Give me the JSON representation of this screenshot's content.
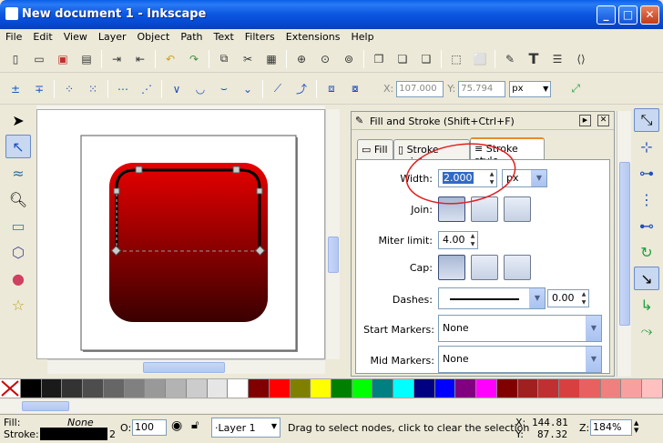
{
  "window": {
    "title": "New document 1 - Inkscape",
    "controls": {
      "minimize": "_",
      "maximize": "□",
      "close": "✕"
    }
  },
  "menubar": [
    "File",
    "Edit",
    "View",
    "Layer",
    "Object",
    "Path",
    "Text",
    "Filters",
    "Extensions",
    "Help"
  ],
  "node_toolbar": {
    "x_label": "X:",
    "x_value": "107.000",
    "y_label": "Y:",
    "y_value": "75.794",
    "unit": "px"
  },
  "dialog": {
    "title": "Fill and Stroke (Shift+Ctrl+F)",
    "tabs": [
      "Fill",
      "Stroke paint",
      "Stroke style"
    ],
    "active_tab": "Stroke style",
    "width_label": "Width:",
    "width_value": "2.000",
    "width_unit": "px",
    "join_label": "Join:",
    "miter_label": "Miter limit:",
    "miter_value": "4.00",
    "cap_label": "Cap:",
    "dashes_label": "Dashes:",
    "dash_offset": "0.00",
    "start_markers_label": "Start Markers:",
    "start_markers_value": "None",
    "mid_markers_label": "Mid Markers:",
    "mid_markers_value": "None"
  },
  "palette": {
    "colors": [
      "#000000",
      "#1a1a1a",
      "#333333",
      "#4d4d4d",
      "#666666",
      "#808080",
      "#999999",
      "#b3b3b3",
      "#cccccc",
      "#e6e6e6",
      "#ffffff",
      "#800000",
      "#ff0000",
      "#808000",
      "#ffff00",
      "#008000",
      "#00ff00",
      "#008080",
      "#00ffff",
      "#000080",
      "#0000ff",
      "#800080",
      "#ff00ff",
      "#800000",
      "#a02020",
      "#c03030",
      "#d84040",
      "#e86060",
      "#f08080",
      "#f8a0a0",
      "#ffc0c0"
    ]
  },
  "statusbar": {
    "fill_label": "Fill:",
    "fill_value": "None",
    "stroke_label": "Stroke:",
    "stroke_width": "2",
    "opacity_label": "O:",
    "opacity_value": "100",
    "layer_name": "·Layer 1",
    "message": "Drag to select nodes, click to clear the selection",
    "x_label": "X:",
    "x_value": "144.81",
    "y_label": "Y:",
    "y_value": "87.32",
    "zoom_label": "Z:",
    "zoom_value": "184%"
  },
  "colors": {
    "titlebar": "#0a5fe8",
    "shape_top": "#e00000",
    "shape_bottom": "#3a0000",
    "annotation_circle": "#e02020"
  }
}
